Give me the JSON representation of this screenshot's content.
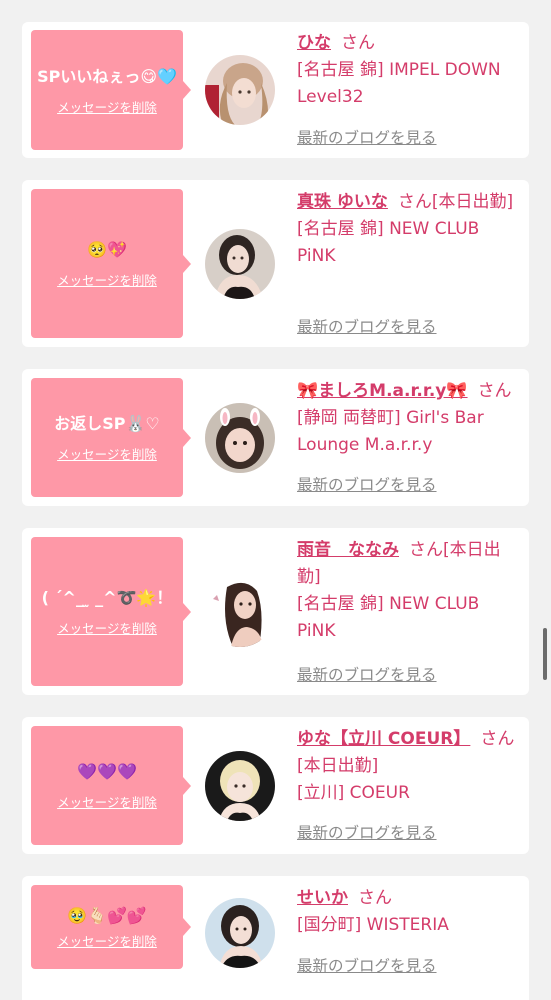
{
  "cards": [
    {
      "message": "SPいいねぇっ😋🩵",
      "delete_label": "メッセージを削除",
      "name": "ひな",
      "honorific": "さん",
      "shop": "[名古屋 錦] IMPEL DOWN Level32",
      "blog_label": "最新のブログを見る",
      "avatar_icon": "avatar-photo"
    },
    {
      "message": "🥺💖",
      "delete_label": "メッセージを削除",
      "name": "真珠 ゆいな",
      "honorific": "さん[本日出勤]",
      "shop": "[名古屋 錦] NEW CLUB PiNK",
      "blog_label": "最新のブログを見る",
      "avatar_icon": "avatar-photo"
    },
    {
      "message": "お返しSP🐰♡",
      "delete_label": "メッセージを削除",
      "name": "🎀ましろM.a.r.r.y🎀",
      "honorific": "さん",
      "shop": "[静岡 両替町] Girl's Bar Lounge M.a.r.r.y",
      "blog_label": "最新のブログを見る",
      "avatar_icon": "avatar-photo"
    },
    {
      "message": "( ˊ^_ ̫ _^➰🌟！",
      "delete_label": "メッセージを削除",
      "name": "雨音　ななみ",
      "honorific": "さん[本日出勤]",
      "shop": "[名古屋 錦] NEW CLUB PiNK",
      "blog_label": "最新のブログを見る",
      "avatar_icon": "avatar-photo"
    },
    {
      "message": "💜💜💜",
      "delete_label": "メッセージを削除",
      "name": "ゆな【立川 COEUR】",
      "honorific": "さん[本日出勤]",
      "shop": "[立川] COEUR",
      "blog_label": "最新のブログを見る",
      "avatar_icon": "avatar-photo"
    },
    {
      "message": "🥹🫰🏻💕💕",
      "delete_label": "メッセージを削除",
      "name": "せいか",
      "honorific": "さん",
      "shop": "[国分町] WISTERIA",
      "blog_label": "最新のブログを見る",
      "avatar_icon": "avatar-photo"
    }
  ],
  "colors": {
    "bubble": "#fe98a7",
    "accent": "#d43c6a",
    "link_gray": "#8a8a8a",
    "background": "#f1f1f1"
  }
}
